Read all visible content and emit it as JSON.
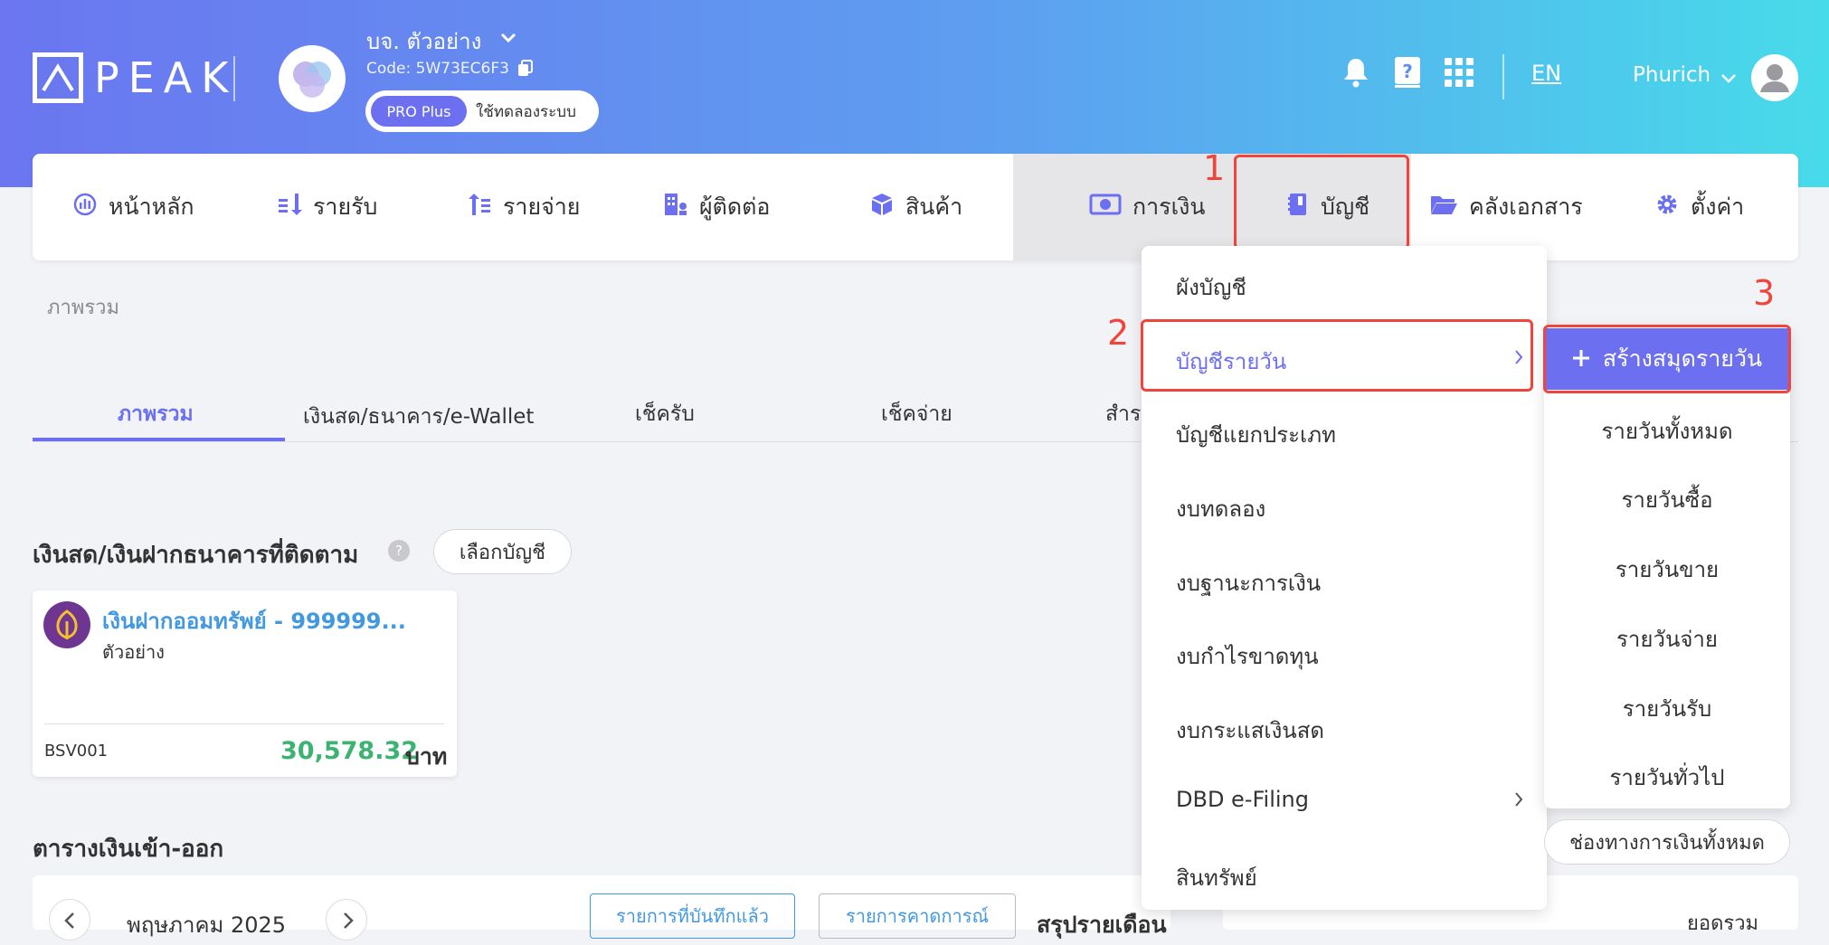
{
  "header": {
    "logo_text": "PEAK",
    "company_name": "บจ. ตัวอย่าง",
    "company_code": "Code: 5W73EC6F3",
    "plan_badge": "PRO Plus",
    "plan_trial": "ใช้ทดลองระบบ",
    "language": "EN",
    "user_name": "Phurich"
  },
  "nav": {
    "items": [
      {
        "label": "หน้าหลัก",
        "icon": "dashboard-icon"
      },
      {
        "label": "รายรับ",
        "icon": "income-icon"
      },
      {
        "label": "รายจ่าย",
        "icon": "expense-icon"
      },
      {
        "label": "ผู้ติดต่อ",
        "icon": "contacts-icon"
      },
      {
        "label": "สินค้า",
        "icon": "box-icon"
      },
      {
        "label": "การเงิน",
        "icon": "money-icon"
      },
      {
        "label": "บัญชี",
        "icon": "ledger-icon"
      },
      {
        "label": "คลังเอกสาร",
        "icon": "folder-icon"
      },
      {
        "label": "ตั้งค่า",
        "icon": "gear-icon"
      }
    ]
  },
  "annotations": {
    "step1": "1",
    "step2": "2",
    "step3": "3"
  },
  "breadcrumb": "ภาพรวม",
  "tabs": [
    "ภาพรวม",
    "เงินสด/ธนาคาร/e-Wallet",
    "เช็ครับ",
    "เช็คจ่าย",
    "สำรอ"
  ],
  "cash_section": {
    "title": "เงินสด/เงินฝากธนาคารที่ติดตาม",
    "help": "?",
    "select_button": "เลือกบัญชี",
    "card": {
      "bank_name": "เงินฝากออมทรัพย์ - 999999...",
      "subtitle": "ตัวอย่าง",
      "code": "BSV001",
      "amount": "30,578.32",
      "currency": "บาท"
    }
  },
  "cashflow_section": {
    "title": "ตารางเงินเข้า-ออก",
    "month": "พฤษภาคม 2025",
    "btn_recorded": "รายการที่บันทึกแล้ว",
    "btn_forecast": "รายการคาดการณ์",
    "summary": "สรุปรายเดือน",
    "right_text": "ยอดรวม"
  },
  "dropdown": {
    "items": [
      "ผังบัญชี",
      "บัญชีรายวัน",
      "บัญชีแยกประเภท",
      "งบทดลอง",
      "งบฐานะการเงิน",
      "งบกำไรขาดทุน",
      "งบกระแสเงินสด",
      "DBD e-Filing",
      "สินทรัพย์"
    ]
  },
  "submenu": {
    "create": "สร้างสมุดรายวัน",
    "items": [
      "รายวันทั้งหมด",
      "รายวันซื้อ",
      "รายวันขาย",
      "รายวันจ่าย",
      "รายวันรับ",
      "รายวันทั่วไป"
    ]
  },
  "channels_button": "ช่องทางการเงินทั้งหมด",
  "colors": {
    "accent": "#6b6ff0",
    "annotation_red": "#f0453a",
    "amount_green": "#3cb371",
    "link_blue": "#4299e1"
  }
}
